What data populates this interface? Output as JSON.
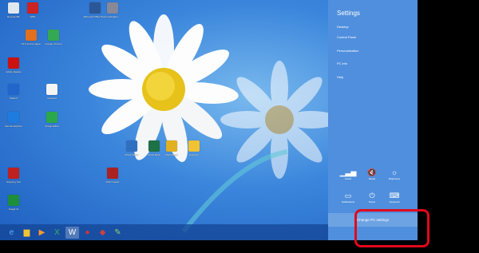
{
  "settings_panel": {
    "title": "Settings",
    "menu": [
      "Desktop",
      "Control Panel",
      "Personalization",
      "PC info",
      "Help"
    ],
    "quick_settings": [
      {
        "label": "Guest",
        "icon": "network-signal-icon",
        "glyph": "▁▃▅"
      },
      {
        "label": "Muted",
        "icon": "volume-muted-icon",
        "glyph": "🔇"
      },
      {
        "label": "Brightness",
        "icon": "brightness-icon",
        "glyph": "☼"
      },
      {
        "label": "Notifications",
        "icon": "notifications-icon",
        "glyph": "▭"
      },
      {
        "label": "Power",
        "icon": "power-icon",
        "glyph": "⏻"
      },
      {
        "label": "Keyboard",
        "icon": "keyboard-icon",
        "glyph": "⌨"
      }
    ],
    "change_pc_settings": "Change PC settings"
  },
  "desktop_icons": [
    {
      "label": "Recycle Bin",
      "color": "#dfe7ef"
    },
    {
      "label": "WSP",
      "color": "#cc2222"
    },
    {
      "label": "NTV and its player",
      "color": "#e07020"
    },
    {
      "label": "Google Chrome",
      "color": "#34a853"
    },
    {
      "label": "Adobe Reader",
      "color": "#cc1111"
    },
    {
      "label": "ShareX",
      "color": "#2266cc"
    },
    {
      "label": "Notepad",
      "color": "#f4f4f4"
    },
    {
      "label": "Internet Explorer",
      "color": "#1e7be0"
    },
    {
      "label": "Snagit Editor",
      "color": "#2aa84a"
    },
    {
      "label": "Microsoft Office Word",
      "color": "#2b5797"
    },
    {
      "label": "Calculator",
      "color": "#889"
    },
    {
      "label": "Movie Maker",
      "color": "#3070c0"
    },
    {
      "label": "Excel 2010",
      "color": "#1e7145"
    },
    {
      "label": "PhotoScape",
      "color": "#e0b020"
    },
    {
      "label": "Explorer",
      "color": "#f1c232"
    },
    {
      "label": "Snipping Tool",
      "color": "#c02020"
    },
    {
      "label": "PDF Creator",
      "color": "#aa2222"
    },
    {
      "label": "Snagit 11",
      "color": "#1d8f3a"
    }
  ],
  "taskbar": [
    {
      "icon": "internet-explorer-icon",
      "glyph": "e",
      "color": "#5ab0ff",
      "active": false
    },
    {
      "icon": "file-explorer-icon",
      "glyph": "▆",
      "color": "#f1c232",
      "active": false
    },
    {
      "icon": "media-player-icon",
      "glyph": "▶",
      "color": "#ff9a2e",
      "active": false
    },
    {
      "icon": "excel-icon",
      "glyph": "X",
      "color": "#35b36a",
      "active": false
    },
    {
      "icon": "word-icon",
      "glyph": "W",
      "color": "#ffffff",
      "active": true
    },
    {
      "icon": "record-icon",
      "glyph": "●",
      "color": "#e03030",
      "active": false
    },
    {
      "icon": "snagit-icon",
      "glyph": "◆",
      "color": "#d04040",
      "active": false
    },
    {
      "icon": "paint-icon",
      "glyph": "✎",
      "color": "#8fd16a",
      "active": false
    }
  ]
}
